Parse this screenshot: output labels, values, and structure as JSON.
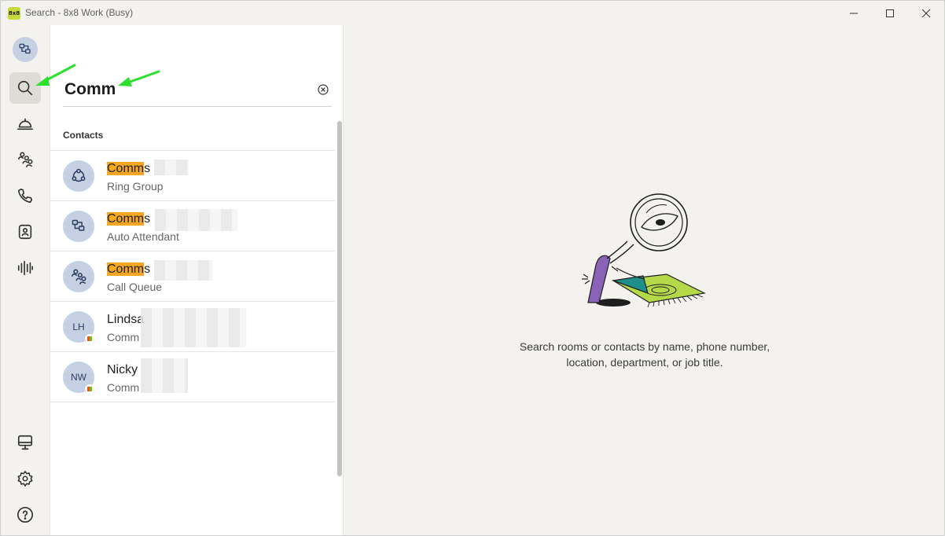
{
  "window": {
    "title": "Search - 8x8 Work (Busy)",
    "logo_text": "8x8"
  },
  "rail": {
    "items": [
      {
        "name": "auto-attendant-avatar"
      },
      {
        "name": "search"
      },
      {
        "name": "service"
      },
      {
        "name": "call-queues"
      },
      {
        "name": "calls"
      },
      {
        "name": "contacts"
      },
      {
        "name": "voicemail"
      },
      {
        "name": "desktop"
      },
      {
        "name": "settings"
      },
      {
        "name": "help"
      }
    ]
  },
  "search": {
    "value": "Comm",
    "placeholder": ""
  },
  "contacts": {
    "title": "Contacts",
    "rows": [
      {
        "highlight": "Comm",
        "name_rest": "s",
        "sub": "Ring Group",
        "avatar": "ring-group-icon"
      },
      {
        "highlight": "Comm",
        "name_rest": "s",
        "sub": "Auto Attendant",
        "avatar": "auto-attendant-icon"
      },
      {
        "highlight": "Comm",
        "name_rest": "s",
        "sub": "Call Queue",
        "avatar": "call-queue-icon"
      },
      {
        "name": "Lindsa",
        "sub": "Comm",
        "initials": "LH"
      },
      {
        "name": "Nicky",
        "sub": "Comm",
        "initials": "NW"
      }
    ]
  },
  "empty_state": {
    "line1": "Search rooms or contacts by name, phone number,",
    "line2": "location, department, or job title."
  },
  "colors": {
    "highlight": "#f5a623",
    "avatar_bg": "#c5d0e3",
    "annotation_arrow": "#2ee02e"
  }
}
